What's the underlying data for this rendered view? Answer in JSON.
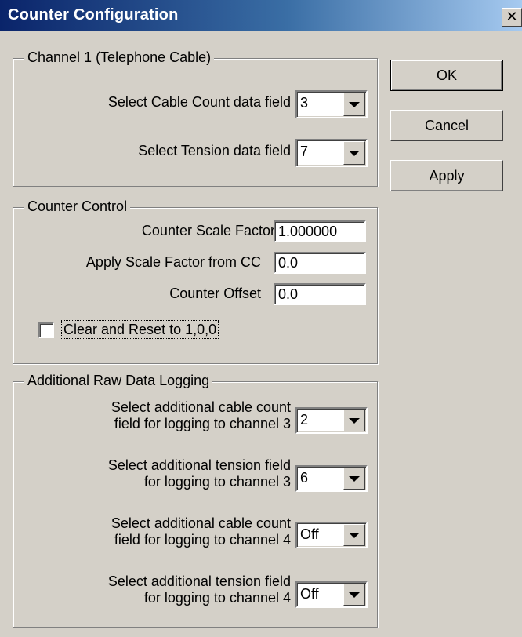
{
  "window": {
    "title": "Counter Configuration",
    "close_glyph": "✕"
  },
  "buttons": {
    "ok": "OK",
    "cancel": "Cancel",
    "apply": "Apply"
  },
  "channel1": {
    "legend": "Channel 1 (Telephone Cable)",
    "cable_count_label": "Select Cable Count data field",
    "cable_count_value": "3",
    "tension_label": "Select Tension data field",
    "tension_value": "7"
  },
  "counter_control": {
    "legend": "Counter Control",
    "scale_factor_label": "Counter Scale Factor",
    "scale_factor_value": "1.000000",
    "apply_scale_label": "Apply Scale Factor from CC",
    "apply_scale_value": "0.0",
    "offset_label": "Counter Offset",
    "offset_value": "0.0",
    "reset_label": "Clear and Reset to 1,0,0",
    "reset_checked": false
  },
  "raw_logging": {
    "legend": "Additional Raw Data Logging",
    "items": [
      {
        "line1": "Select additional cable count",
        "line2": "field for logging to channel 3",
        "value": "2"
      },
      {
        "line1": "Select additional tension field",
        "line2": "for logging to channel 3",
        "value": "6"
      },
      {
        "line1": "Select additional cable count",
        "line2": "field for logging to channel 4",
        "value": "Off"
      },
      {
        "line1": "Select additional tension field",
        "line2": "for logging to channel 4",
        "value": "Off"
      }
    ]
  }
}
